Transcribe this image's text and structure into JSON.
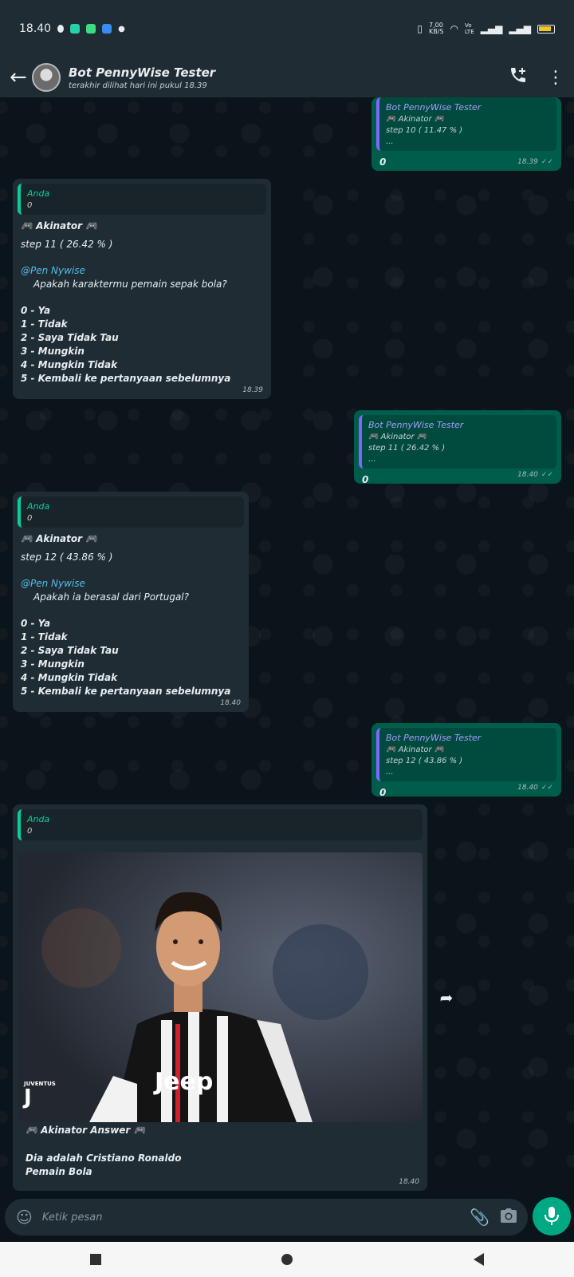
{
  "status_bar": {
    "time": "18.40",
    "net_speed_top": "7,00",
    "net_speed_bottom": "KB/S",
    "volte_top": "Vo",
    "volte_bottom": "LTE"
  },
  "header": {
    "title": "Bot PennyWise Tester",
    "subtitle": "terakhir dilihat hari ini pukul 18.39"
  },
  "messages": [
    {
      "quote_author": "Bot PennyWise Tester",
      "quote_lines": [
        "🎮 Akinator 🎮",
        "step 10 ( 11.47 % )",
        "..."
      ],
      "text": "0",
      "time": "18.39"
    },
    {
      "quote_author": "Anda",
      "quote_line": "0",
      "title": "🎮 Akinator 🎮",
      "step": "step 11 ( 26.42 % )",
      "mention": "@Pen Nywise",
      "question": "Apakah karaktermu pemain sepak bola?",
      "options": [
        "0 - Ya",
        "1 - Tidak",
        "2 - Saya Tidak Tau",
        "3 - Mungkin",
        "4 - Mungkin Tidak",
        "5 - Kembali ke pertanyaan sebelumnya"
      ],
      "time": "18.39"
    },
    {
      "quote_author": "Bot PennyWise Tester",
      "quote_lines": [
        "🎮 Akinator 🎮",
        "step 11 ( 26.42 % )",
        "..."
      ],
      "text": "0",
      "time": "18.40"
    },
    {
      "quote_author": "Anda",
      "quote_line": "0",
      "title": "🎮 Akinator 🎮",
      "step": "step 12 ( 43.86 % )",
      "mention": "@Pen Nywise",
      "question": "Apakah ia berasal dari Portugal?",
      "options": [
        "0 - Ya",
        "1 - Tidak",
        "2 - Saya Tidak Tau",
        "3 - Mungkin",
        "4 - Mungkin Tidak",
        "5 - Kembali ke pertanyaan sebelumnya"
      ],
      "time": "18.40"
    },
    {
      "quote_author": "Bot PennyWise Tester",
      "quote_lines": [
        "🎮 Akinator 🎮",
        "step 12 ( 43.86 % )",
        "..."
      ],
      "text": "0",
      "time": "18.40"
    },
    {
      "quote_author": "Anda",
      "quote_line": "0",
      "photo_logo_text": "JUVENTUS",
      "photo_jersey_text": "Jeep",
      "answer_title": "🎮 Akinator Answer 🎮",
      "answer_line1": "Dia adalah Cristiano Ronaldo",
      "answer_line2": "Pemain Bola",
      "time": "18.40"
    }
  ],
  "composer": {
    "placeholder": "Ketik pesan"
  },
  "colors": {
    "bg": "#0b141a",
    "header": "#1f2c34",
    "outgoing": "#005c4b",
    "incoming": "#1f2c34",
    "accent": "#00a884"
  }
}
